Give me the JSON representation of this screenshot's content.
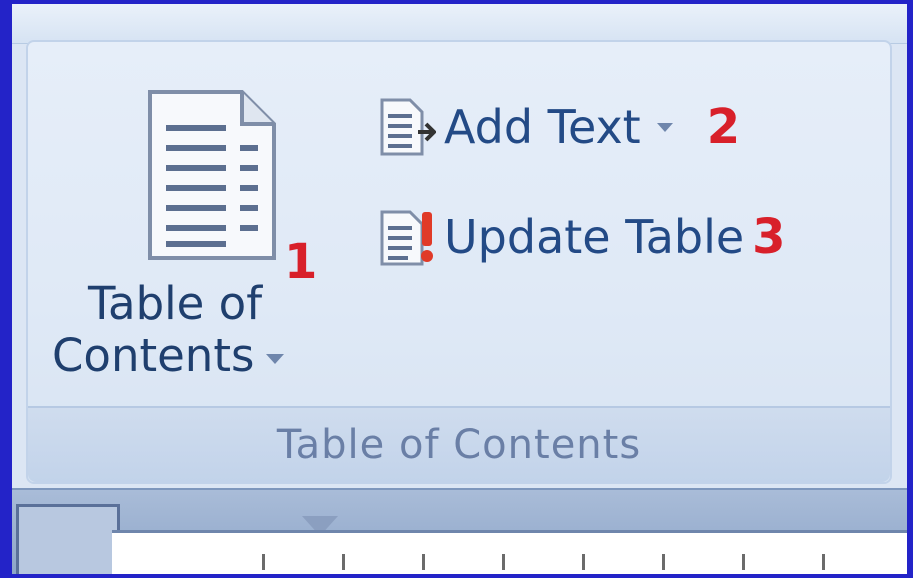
{
  "group": {
    "label": "Table of Contents"
  },
  "toc_button": {
    "label_line1": "Table of",
    "label_line2": "Contents",
    "marker": "1"
  },
  "add_text": {
    "label": "Add Text",
    "marker": "2"
  },
  "update_table": {
    "label": "Update Table",
    "marker": "3"
  },
  "colors": {
    "frame_border": "#2323c8",
    "ribbon_bg": "#dce6f4",
    "label_text": "#234a86",
    "marker_red": "#d8202a"
  },
  "icons": {
    "toc": "document-list-icon",
    "add_text": "add-text-icon",
    "update_table": "update-table-icon"
  }
}
